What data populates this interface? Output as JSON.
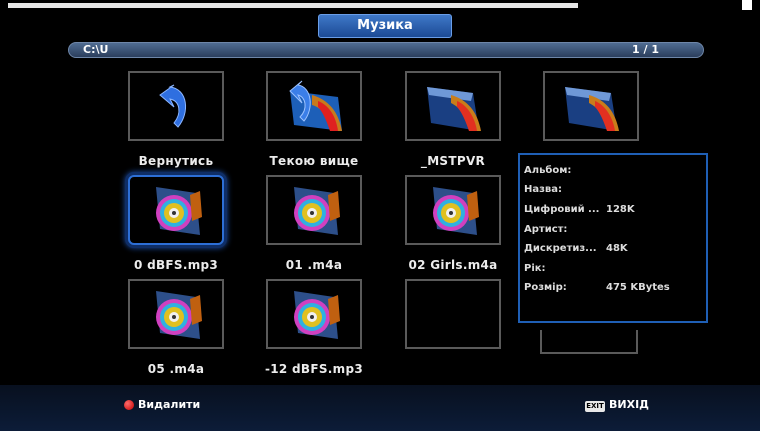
{
  "header": {
    "title": "Музика"
  },
  "pathbar": {
    "path": "C:\\U",
    "page": "1 / 1"
  },
  "grid": {
    "items": [
      {
        "label": "Вернутись",
        "icon": "return-icon"
      },
      {
        "label": "Текою вище",
        "icon": "folder-up-icon"
      },
      {
        "label": "_MSTPVR",
        "icon": "folder-icon"
      },
      {
        "label": "",
        "icon": "folder-icon"
      },
      {
        "label": "0 dBFS.mp3",
        "icon": "music-file-icon",
        "selected": true
      },
      {
        "label": "01 .m4a",
        "icon": "music-file-icon"
      },
      {
        "label": "02 Girls.m4a",
        "icon": "music-file-icon"
      },
      {
        "label": "05 .m4a",
        "icon": "music-file-icon"
      },
      {
        "label": "-12 dBFS.mp3",
        "icon": "music-file-icon"
      },
      {
        "label": "",
        "icon": ""
      }
    ]
  },
  "info": {
    "rows": [
      {
        "key": "Альбом:",
        "value": ""
      },
      {
        "key": "Назва:",
        "value": ""
      },
      {
        "key": "Цифровий ...",
        "value": "128K"
      },
      {
        "key": "Артист:",
        "value": ""
      },
      {
        "key": "Дискретиз...",
        "value": "48K"
      },
      {
        "key": "Рік:",
        "value": ""
      },
      {
        "key": "Розмір:",
        "value": "475 KBytes"
      }
    ]
  },
  "footer": {
    "delete_label": "Видалити",
    "exit_key": "EXIT",
    "exit_label": "ВИХІД"
  },
  "colors": {
    "accent": "#2d6fd6",
    "delete": "#d40000"
  }
}
